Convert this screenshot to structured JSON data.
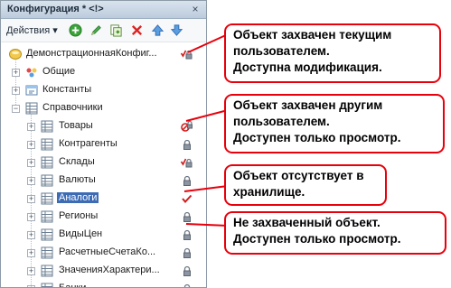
{
  "panel": {
    "title": "Конфигурация * <!>",
    "close_glyph": "×",
    "toolbar": {
      "actions_label": "Действия",
      "actions_arrow": "▾",
      "buttons": [
        "add-circle-icon",
        "edit-pencil-icon",
        "copy-document-icon",
        "delete-cross-icon",
        "move-up-icon",
        "move-down-icon"
      ]
    }
  },
  "tree": [
    {
      "label": "ДемонстрационнаяКонфиг...",
      "icon": "configuration-icon",
      "expander": "",
      "state": "captured-current-lock-icon",
      "selected": false
    },
    {
      "label": "Общие",
      "icon": "common-icon",
      "expander": "+",
      "state": "",
      "selected": false
    },
    {
      "label": "Константы",
      "icon": "constants-icon",
      "expander": "+",
      "state": "",
      "selected": false
    },
    {
      "label": "Справочники",
      "icon": "catalogs-icon",
      "expander": "−",
      "state": "",
      "selected": false
    },
    {
      "label": "Товары",
      "icon": "catalog-icon",
      "expander": "+",
      "state": "captured-other-lock-icon",
      "selected": false
    },
    {
      "label": "Контрагенты",
      "icon": "catalog-icon",
      "expander": "+",
      "state": "lock-icon",
      "selected": false
    },
    {
      "label": "Склады",
      "icon": "catalog-icon",
      "expander": "+",
      "state": "captured-current-lock-icon",
      "selected": false
    },
    {
      "label": "Валюты",
      "icon": "catalog-icon",
      "expander": "+",
      "state": "lock-icon",
      "selected": false
    },
    {
      "label": "Аналоги",
      "icon": "catalog-icon",
      "expander": "+",
      "state": "checkmark-icon",
      "selected": true
    },
    {
      "label": "Регионы",
      "icon": "catalog-icon",
      "expander": "+",
      "state": "lock-icon",
      "selected": false
    },
    {
      "label": "ВидыЦен",
      "icon": "catalog-icon",
      "expander": "+",
      "state": "lock-icon",
      "selected": false
    },
    {
      "label": "РасчетныеСчетаКо...",
      "icon": "catalog-icon",
      "expander": "+",
      "state": "lock-icon",
      "selected": false
    },
    {
      "label": "ЗначенияХарактери...",
      "icon": "catalog-icon",
      "expander": "+",
      "state": "lock-icon",
      "selected": false
    },
    {
      "label": "Банки",
      "icon": "catalog-icon",
      "expander": "+",
      "state": "lock-icon",
      "selected": false
    }
  ],
  "callouts": [
    {
      "lines": [
        "Объект захвачен текущим",
        "пользователем.",
        "Доступна модификация."
      ]
    },
    {
      "lines": [
        "Объект захвачен другим",
        "пользователем.",
        "Доступен только просмотр."
      ]
    },
    {
      "lines": [
        "Объект отсутствует в",
        "хранилище."
      ]
    },
    {
      "lines": [
        "Не захваченный объект.",
        "Доступен только просмотр."
      ]
    }
  ],
  "colors": {
    "callout_border": "#e8000b",
    "selection": "#3d6cb5",
    "titlebar": "#c9d6e4"
  }
}
